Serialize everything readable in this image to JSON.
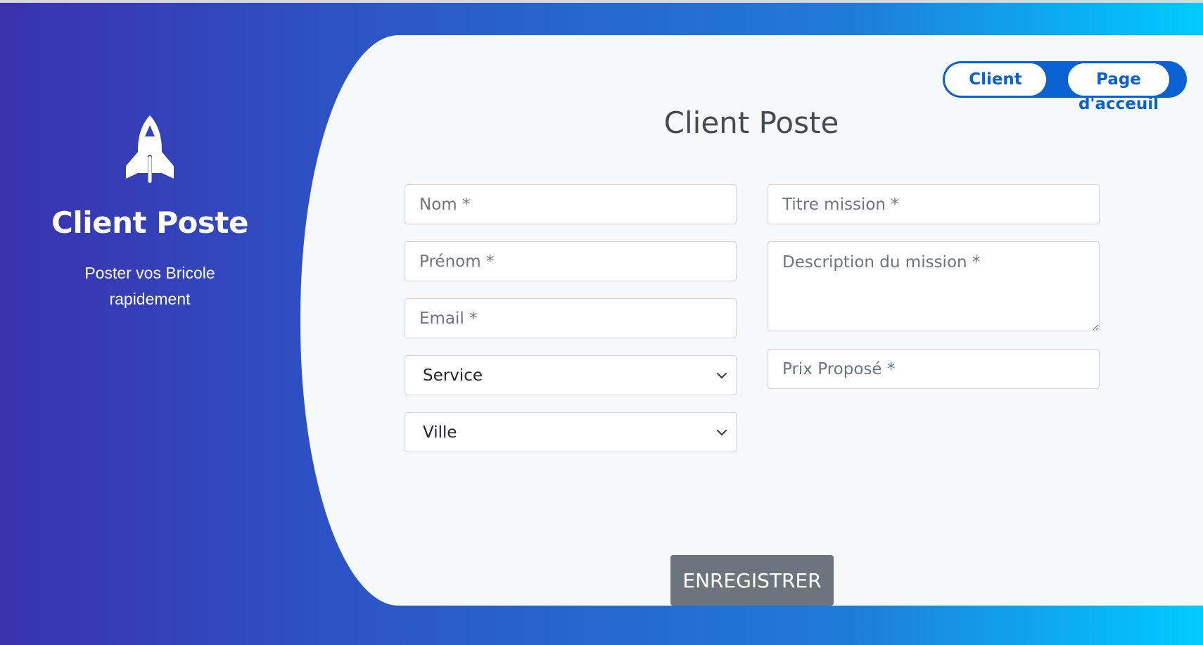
{
  "left_panel": {
    "icon": "rocket-icon",
    "title": "Client Poste",
    "subtitle": "Poster vos Bricole rapidement"
  },
  "toggle": {
    "client_label": "Client",
    "home_label_line1": "Page",
    "home_label_line2": "d'acceuil"
  },
  "form": {
    "title": "Client Poste",
    "fields": {
      "nom_placeholder": "Nom *",
      "prenom_placeholder": "Prénom *",
      "email_placeholder": "Email *",
      "service_selected": "Service",
      "ville_selected": "Ville",
      "titre_placeholder": "Titre mission *",
      "description_placeholder": "Description du mission *",
      "prix_placeholder": "Prix Proposé *"
    },
    "submit_label": "ENREGISTRER"
  },
  "colors": {
    "gradient_start": "#3a31ad",
    "gradient_end": "#00cbff",
    "accent": "#0a62d2",
    "submit_bg": "#6c757d"
  }
}
